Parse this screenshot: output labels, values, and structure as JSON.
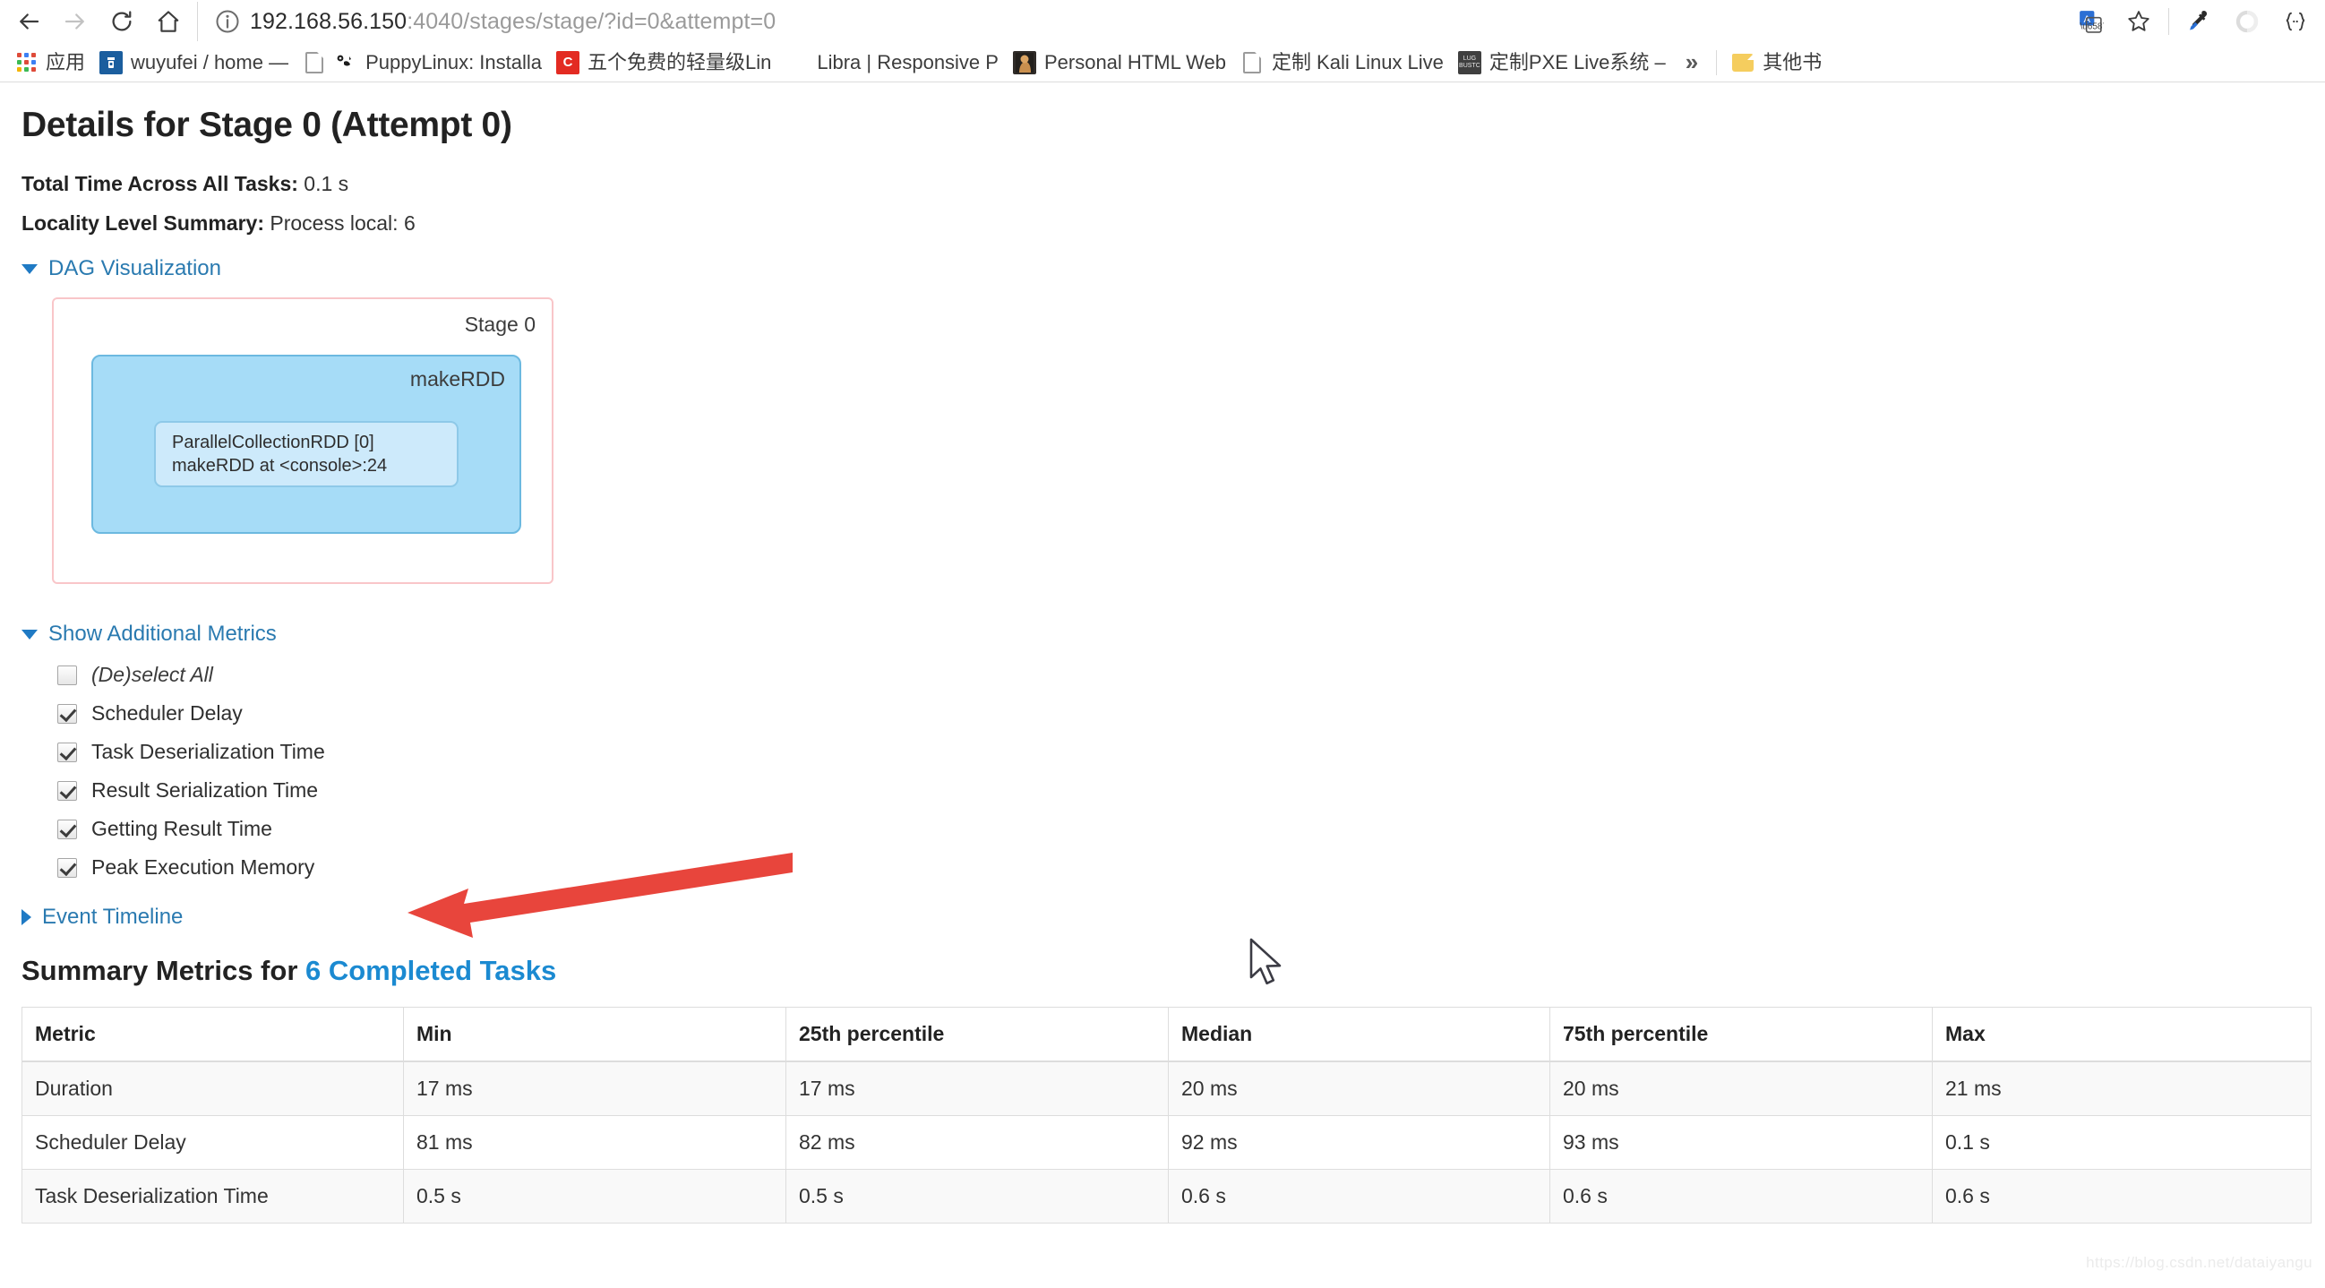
{
  "browser": {
    "nav": {
      "back_icon": "arrow-left-icon",
      "forward_icon": "arrow-right-icon",
      "reload_icon": "reload-icon",
      "home_icon": "home-icon"
    },
    "omnibox": {
      "info_icon": "page-info-icon",
      "url_host": "192.168.56.150",
      "url_path": ":4040/stages/stage/?id=0&attempt=0",
      "url_full": "192.168.56.150:4040/stages/stage/?id=0&attempt=0"
    },
    "toolbar_right": [
      {
        "name": "translate-icon",
        "glyph": "译"
      },
      {
        "name": "bookmark-star-icon",
        "glyph": "☆"
      },
      {
        "name": "eyedropper-extension-icon",
        "glyph": "✐"
      },
      {
        "name": "circle-extension-icon",
        "glyph": "○"
      },
      {
        "name": "braces-extension-icon",
        "glyph": "{..}"
      }
    ],
    "bookmarks": {
      "apps_label": "应用",
      "apps_icon": "apps-grid-icon",
      "items": [
        {
          "label": "wuyufei / home — ",
          "icon": "bitbucket-favicon"
        },
        {
          "label": "PuppyLinux: Installa",
          "icon": "page-favicon"
        },
        {
          "label": "五个免费的轻量级Lin",
          "icon": "csdn-favicon"
        },
        {
          "label": "Libra | Responsive P",
          "icon": "blank-favicon"
        },
        {
          "label": "Personal HTML Web",
          "icon": "portrait-favicon"
        },
        {
          "label": "定制 Kali Linux Live",
          "icon": "page-favicon"
        },
        {
          "label": "定制PXE Live系统 – ",
          "icon": "lug-favicon"
        }
      ],
      "overflow_glyph": "»",
      "other_bookmarks_label": "其他书",
      "other_bookmarks_icon": "folder-icon"
    }
  },
  "page": {
    "title": "Details for Stage 0 (Attempt 0)",
    "total_time_label": "Total Time Across All Tasks:",
    "total_time_value": "0.1 s",
    "locality_label": "Locality Level Summary:",
    "locality_value": "Process local: 6",
    "dag": {
      "toggle_label": "DAG Visualization",
      "expanded": true,
      "stage_label": "Stage 0",
      "operation_label": "makeRDD",
      "rdd_label": "ParallelCollectionRDD [0]\nmakeRDD at <console>:24"
    },
    "additional_metrics": {
      "toggle_label": "Show Additional Metrics",
      "expanded": true,
      "options": [
        {
          "label": "(De)select All",
          "checked": false,
          "italic": true
        },
        {
          "label": "Scheduler Delay",
          "checked": true,
          "italic": false
        },
        {
          "label": "Task Deserialization Time",
          "checked": true,
          "italic": false
        },
        {
          "label": "Result Serialization Time",
          "checked": true,
          "italic": false
        },
        {
          "label": "Getting Result Time",
          "checked": true,
          "italic": false
        },
        {
          "label": "Peak Execution Memory",
          "checked": true,
          "italic": false
        }
      ]
    },
    "event_timeline": {
      "toggle_label": "Event Timeline",
      "expanded": false
    },
    "summary_metrics": {
      "title_prefix": "Summary Metrics for ",
      "title_link": "6 Completed Tasks",
      "columns": [
        "Metric",
        "Min",
        "25th percentile",
        "Median",
        "75th percentile",
        "Max"
      ],
      "rows": [
        [
          "Duration",
          "17 ms",
          "17 ms",
          "20 ms",
          "20 ms",
          "21 ms"
        ],
        [
          "Scheduler Delay",
          "81 ms",
          "82 ms",
          "92 ms",
          "93 ms",
          "0.1 s"
        ],
        [
          "Task Deserialization Time",
          "0.5 s",
          "0.5 s",
          "0.6 s",
          "0.6 s",
          "0.6 s"
        ]
      ]
    },
    "watermark": "https://blog.csdn.net/dataiyangu",
    "annotation_arrow_icon": "red-arrow-left-annotation",
    "mouse_cursor_icon": "mouse-pointer-cursor"
  }
}
